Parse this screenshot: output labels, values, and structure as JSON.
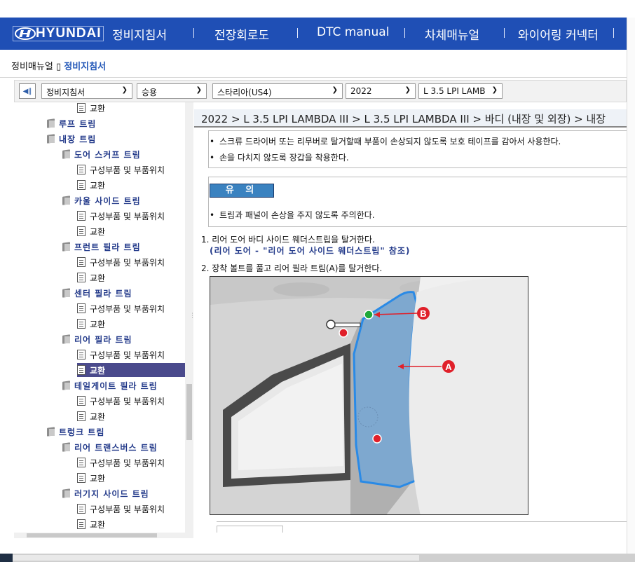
{
  "nav": {
    "brand": "HYUNDAI",
    "items": [
      "정비지침서",
      "전장회로도",
      "DTC manual",
      "차체매뉴얼",
      "와이어링 커넥터"
    ]
  },
  "breadcrumb": {
    "root": "정비매뉴얼",
    "sep": "▯",
    "current": "정비지침서"
  },
  "toolbar": {
    "collapse": "◀‖",
    "selects": [
      "정비지침서",
      "승용",
      "스타리아(US4)",
      "2022",
      "L 3.5 LPI LAMB"
    ]
  },
  "tree": [
    {
      "label": "교환",
      "type": "doc"
    },
    {
      "label": "루프 트림",
      "type": "book",
      "level": 1
    },
    {
      "label": "내장 트림",
      "type": "book",
      "level": 1
    },
    {
      "label": "도어 스커프 트림",
      "type": "book",
      "level": 2
    },
    {
      "label": "구성부품 및 부품위치",
      "type": "doc"
    },
    {
      "label": "교환",
      "type": "doc"
    },
    {
      "label": "카울 사이드 트림",
      "type": "book",
      "level": 2
    },
    {
      "label": "구성부품 및 부품위치",
      "type": "doc"
    },
    {
      "label": "교환",
      "type": "doc"
    },
    {
      "label": "프런트 필라 트림",
      "type": "book",
      "level": 2
    },
    {
      "label": "구성부품 및 부품위치",
      "type": "doc"
    },
    {
      "label": "교환",
      "type": "doc"
    },
    {
      "label": "센터 필라 트림",
      "type": "book",
      "level": 2
    },
    {
      "label": "구성부품 및 부품위치",
      "type": "doc"
    },
    {
      "label": "교환",
      "type": "doc"
    },
    {
      "label": "리어 필라 트림",
      "type": "book",
      "level": 2
    },
    {
      "label": "구성부품 및 부품위치",
      "type": "doc"
    },
    {
      "label": "교환",
      "type": "doc",
      "selected": true
    },
    {
      "label": "테일게이트 필라 트림",
      "type": "book",
      "level": 2
    },
    {
      "label": "구성부품 및 부품위치",
      "type": "doc"
    },
    {
      "label": "교환",
      "type": "doc"
    },
    {
      "label": "트렁크 트림",
      "type": "book",
      "level": 1
    },
    {
      "label": "리어 트랜스버스 트림",
      "type": "book",
      "level": 2
    },
    {
      "label": "구성부품 및 부품위치",
      "type": "doc"
    },
    {
      "label": "교환",
      "type": "doc"
    },
    {
      "label": "러기지 사이드 트림",
      "type": "book",
      "level": 2
    },
    {
      "label": "구성부품 및 부품위치",
      "type": "doc"
    },
    {
      "label": "교환",
      "type": "doc"
    }
  ],
  "content": {
    "path": "2022 > L 3.5 LPI LAMBDA III > L 3.5 LPI LAMBDA III > 바디 (내장 및 외장) > 내장",
    "warnings": [
      "스크류 드라이버 또는 리무버로 탈거할때 부품이 손상되지 않도록 보호 테이프를 감아서 사용한다.",
      "손을 다치지 않도록 장갑을 착용한다."
    ],
    "caution_label": "유 의",
    "caution_items": [
      "트림과 패널이 손상을 주지 않도록 주의한다."
    ],
    "steps": [
      "1. 리어 도어 바디 사이드 웨더스트립을 탈거한다.",
      "2. 장착 볼트를 풀고 리어 필라 트림(A)를 탈거한다."
    ],
    "step1_ref": "(리어 도어 - \"리어 도어 사이드 웨더스트립\" 참조)",
    "bullet": "•",
    "figure_labels": {
      "a": "A",
      "b": "B"
    }
  },
  "colors": {
    "nav_bg": "#1f4fb5",
    "accent": "#2458b8",
    "caution": "#3a82c0",
    "trim_fill": "#7ea8cf",
    "marker_red": "#e0202a",
    "marker_green": "#1fa83a"
  }
}
